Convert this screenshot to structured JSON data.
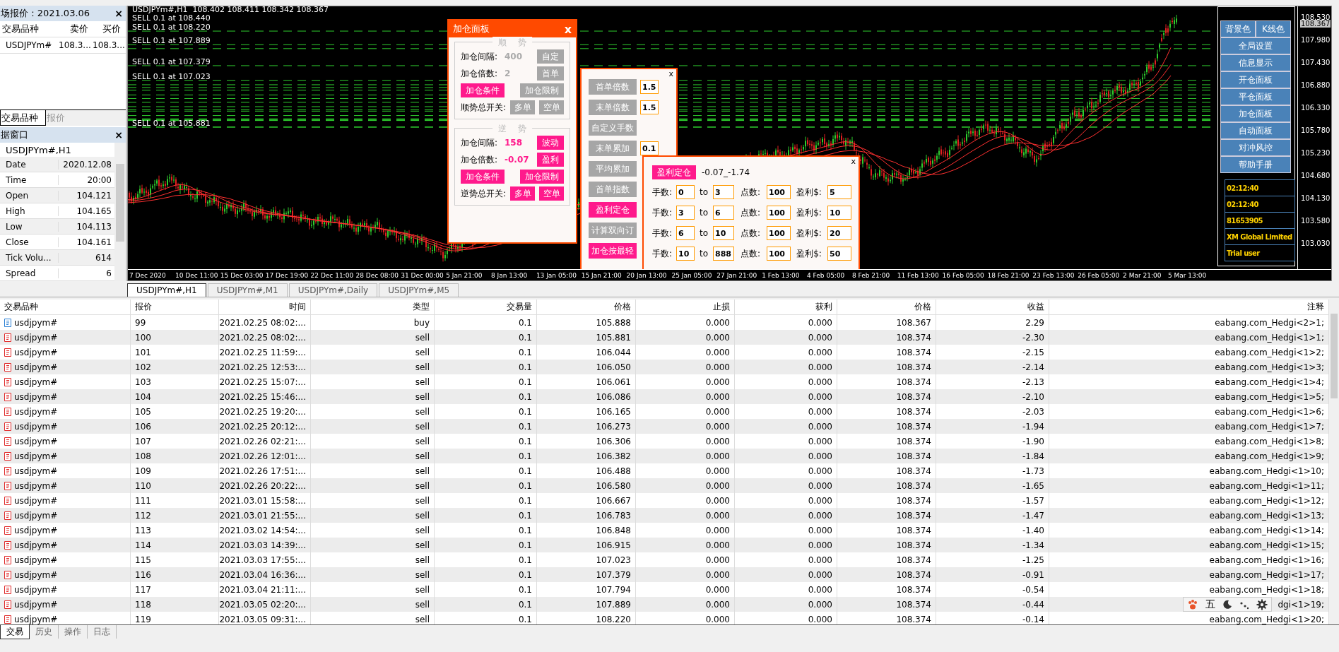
{
  "market_watch": {
    "title": "场报价 : 2021.03.06",
    "close": "×",
    "columns": [
      "交易品种",
      "卖价",
      "买价"
    ],
    "rows": [
      {
        "symbol": "USDJPYm#",
        "bid": "108.3...",
        "ask": "108.3..."
      }
    ],
    "tabs": [
      {
        "label": "交易品种",
        "selected": true
      },
      {
        "label": "报价",
        "selected": false
      }
    ]
  },
  "data_window": {
    "title": "据窗口",
    "close": "×",
    "symbol": "USDJPYm#,H1",
    "rows": [
      {
        "name": "Date",
        "value": "2020.12.08"
      },
      {
        "name": "Time",
        "value": "20:00"
      },
      {
        "name": "Open",
        "value": "104.121"
      },
      {
        "name": "High",
        "value": "104.165"
      },
      {
        "name": "Low",
        "value": "104.113"
      },
      {
        "name": "Close",
        "value": "104.161"
      },
      {
        "name": "Tick Volu...",
        "value": "614"
      },
      {
        "name": "Spread",
        "value": "6"
      }
    ]
  },
  "chart": {
    "legend": "USDJPYm#,H1  108.402 108.411 108.342 108.367",
    "order_labels": [
      "SELL 0.1 at 108.440",
      "SELL 0.1 at 108.220",
      "SELL 0.1 at 107.889",
      "SELL 0.1 at 107.379",
      "SELL 0.1 at 107.023",
      "SELL 0.1 at 105.881"
    ],
    "price_axis": [
      {
        "label": "108.530",
        "current": false
      },
      {
        "label": "108.367",
        "current": true
      },
      {
        "label": "107.980",
        "current": false
      },
      {
        "label": "107.430",
        "current": false
      },
      {
        "label": "106.880",
        "current": false
      },
      {
        "label": "106.330",
        "current": false
      },
      {
        "label": "105.780",
        "current": false
      },
      {
        "label": "105.230",
        "current": false
      },
      {
        "label": "104.680",
        "current": false
      },
      {
        "label": "104.130",
        "current": false
      },
      {
        "label": "103.580",
        "current": false
      },
      {
        "label": "103.030",
        "current": false
      }
    ],
    "time_axis": [
      "7 Dec 2020",
      "10 Dec 11:00",
      "15 Dec 03:00",
      "17 Dec 19:00",
      "22 Dec 11:00",
      "28 Dec 08:00",
      "31 Dec 00:00",
      "5 Jan 21:00",
      "8 Jan 13:00",
      "13 Jan 05:00",
      "15 Jan 21:00",
      "20 Jan 13:00",
      "25 Jan 05:00",
      "27 Jan 21:00",
      "1 Feb 13:00",
      "4 Feb 05:00",
      "8 Feb 21:00",
      "11 Feb 13:00",
      "16 Feb 05:00",
      "18 Feb 21:00",
      "23 Feb 13:00",
      "26 Feb 05:00",
      "2 Mar 21:00",
      "5 Mar 13:00"
    ]
  },
  "add_panel": {
    "title": "加仓面板",
    "close": "x",
    "sections": [
      {
        "legend": "顺 势",
        "highlighted": false,
        "rows": [
          {
            "label": "加仓间隔:",
            "value": "400",
            "button": {
              "label": "自定",
              "active": false
            }
          },
          {
            "label": "加仓倍数:",
            "value": "2",
            "button": {
              "label": "首单",
              "active": false
            }
          }
        ],
        "buttons": [
          {
            "label": "加仓条件",
            "active": true
          },
          {
            "label": "加仓限制",
            "active": false
          }
        ],
        "switch_label": "顺势总开关:",
        "switches": [
          {
            "label": "多单",
            "active": false
          },
          {
            "label": "空单",
            "active": false
          }
        ]
      },
      {
        "legend": "逆 势",
        "highlighted": true,
        "rows": [
          {
            "label": "加仓间隔:",
            "value": "158",
            "button": {
              "label": "波动",
              "active": true
            }
          },
          {
            "label": "加仓倍数:",
            "value": "-0.07",
            "button": {
              "label": "盈利",
              "active": true
            }
          }
        ],
        "buttons": [
          {
            "label": "加仓条件",
            "active": true
          },
          {
            "label": "加仓限制",
            "active": true
          }
        ],
        "switch_label": "逆势总开关:",
        "switches": [
          {
            "label": "多单",
            "active": true
          },
          {
            "label": "空单",
            "active": true
          }
        ]
      }
    ]
  },
  "multiplier_panel": {
    "close": "x",
    "items": [
      {
        "label": "首单倍数",
        "active": false,
        "value": "1.5"
      },
      {
        "label": "末单倍数",
        "active": false,
        "value": "1.5"
      },
      {
        "label": "自定义手数",
        "active": false
      },
      {
        "label": "末单累加",
        "active": false,
        "value": "0.1"
      },
      {
        "label": "平均累加",
        "active": false
      },
      {
        "label": "首单指数",
        "active": false
      },
      {
        "label": "盈利定仓",
        "active": true
      },
      {
        "label": "计算双向订",
        "active": false
      },
      {
        "label": "加仓按最轻",
        "active": true
      }
    ]
  },
  "profit_panel": {
    "close": "x",
    "button": {
      "label": "盈利定仓",
      "active": true
    },
    "summary": "-0.07_-1.74",
    "rows": [
      {
        "lots_label": "手数:",
        "from": "0",
        "to_label": "to",
        "to": "3",
        "points_label": "点数:",
        "points": "100",
        "profit_label": "盈利$:",
        "profit": "5"
      },
      {
        "lots_label": "手数:",
        "from": "3",
        "to_label": "to",
        "to": "6",
        "points_label": "点数:",
        "points": "100",
        "profit_label": "盈利$:",
        "profit": "10"
      },
      {
        "lots_label": "手数:",
        "from": "6",
        "to_label": "to",
        "to": "10",
        "points_label": "点数:",
        "points": "100",
        "profit_label": "盈利$:",
        "profit": "20"
      },
      {
        "lots_label": "手数:",
        "from": "10",
        "to_label": "to",
        "to": "888",
        "points_label": "点数:",
        "points": "100",
        "profit_label": "盈利$:",
        "profit": "50"
      }
    ]
  },
  "side_menu": {
    "top": [
      "背景色",
      "K线色"
    ],
    "items": [
      "全局设置",
      "信息显示",
      "开仓面板",
      "平仓面板",
      "加仓面板",
      "自动面板",
      "对冲风控",
      "帮助手册"
    ]
  },
  "info_box": [
    "02:12:40",
    "02:12:40",
    "81653905",
    "XM Global Limited",
    "Trial user"
  ],
  "chart_tabs": [
    {
      "label": "USDJPYm#,H1",
      "selected": true
    },
    {
      "label": "USDJPYm#,M1",
      "selected": false
    },
    {
      "label": "USDJPYm#,Daily",
      "selected": false
    },
    {
      "label": "USDJPYm#,M5",
      "selected": false
    }
  ],
  "trades": {
    "columns": [
      "交易品种",
      "报价",
      "时间",
      "类型",
      "交易量",
      "价格",
      "止损",
      "获利",
      "价格",
      "收益",
      "注释"
    ],
    "rows": [
      {
        "color": "#2a7fd4",
        "cells": [
          "usdjpym#",
          "99",
          "2021.02.25 08:02:...",
          "buy",
          "0.1",
          "105.888",
          "0.000",
          "0.000",
          "108.367",
          "2.29",
          "eabang.com_Hedgi<2>1;"
        ]
      },
      {
        "color": "#e02828",
        "cells": [
          "usdjpym#",
          "100",
          "2021.02.25 08:02:...",
          "sell",
          "0.1",
          "105.881",
          "0.000",
          "0.000",
          "108.374",
          "-2.30",
          "eabang.com_Hedgi<1>1;"
        ]
      },
      {
        "color": "#e02828",
        "cells": [
          "usdjpym#",
          "101",
          "2021.02.25 11:59:...",
          "sell",
          "0.1",
          "106.044",
          "0.000",
          "0.000",
          "108.374",
          "-2.15",
          "eabang.com_Hedgi<1>2;"
        ]
      },
      {
        "color": "#e02828",
        "cells": [
          "usdjpym#",
          "102",
          "2021.02.25 12:53:...",
          "sell",
          "0.1",
          "106.050",
          "0.000",
          "0.000",
          "108.374",
          "-2.14",
          "eabang.com_Hedgi<1>3;"
        ]
      },
      {
        "color": "#e02828",
        "cells": [
          "usdjpym#",
          "103",
          "2021.02.25 15:07:...",
          "sell",
          "0.1",
          "106.061",
          "0.000",
          "0.000",
          "108.374",
          "-2.13",
          "eabang.com_Hedgi<1>4;"
        ]
      },
      {
        "color": "#e02828",
        "cells": [
          "usdjpym#",
          "104",
          "2021.02.25 15:46:...",
          "sell",
          "0.1",
          "106.086",
          "0.000",
          "0.000",
          "108.374",
          "-2.10",
          "eabang.com_Hedgi<1>5;"
        ]
      },
      {
        "color": "#e02828",
        "cells": [
          "usdjpym#",
          "105",
          "2021.02.25 19:20:...",
          "sell",
          "0.1",
          "106.165",
          "0.000",
          "0.000",
          "108.374",
          "-2.03",
          "eabang.com_Hedgi<1>6;"
        ]
      },
      {
        "color": "#e02828",
        "cells": [
          "usdjpym#",
          "106",
          "2021.02.25 20:12:...",
          "sell",
          "0.1",
          "106.273",
          "0.000",
          "0.000",
          "108.374",
          "-1.94",
          "eabang.com_Hedgi<1>7;"
        ]
      },
      {
        "color": "#e02828",
        "cells": [
          "usdjpym#",
          "107",
          "2021.02.26 02:21:...",
          "sell",
          "0.1",
          "106.306",
          "0.000",
          "0.000",
          "108.374",
          "-1.90",
          "eabang.com_Hedgi<1>8;"
        ]
      },
      {
        "color": "#e02828",
        "cells": [
          "usdjpym#",
          "108",
          "2021.02.26 12:01:...",
          "sell",
          "0.1",
          "106.382",
          "0.000",
          "0.000",
          "108.374",
          "-1.84",
          "eabang.com_Hedgi<1>9;"
        ]
      },
      {
        "color": "#e02828",
        "cells": [
          "usdjpym#",
          "109",
          "2021.02.26 17:51:...",
          "sell",
          "0.1",
          "106.488",
          "0.000",
          "0.000",
          "108.374",
          "-1.73",
          "eabang.com_Hedgi<1>10;"
        ]
      },
      {
        "color": "#e02828",
        "cells": [
          "usdjpym#",
          "110",
          "2021.02.26 20:22:...",
          "sell",
          "0.1",
          "106.580",
          "0.000",
          "0.000",
          "108.374",
          "-1.65",
          "eabang.com_Hedgi<1>11;"
        ]
      },
      {
        "color": "#e02828",
        "cells": [
          "usdjpym#",
          "111",
          "2021.03.01 15:58:...",
          "sell",
          "0.1",
          "106.667",
          "0.000",
          "0.000",
          "108.374",
          "-1.57",
          "eabang.com_Hedgi<1>12;"
        ]
      },
      {
        "color": "#e02828",
        "cells": [
          "usdjpym#",
          "112",
          "2021.03.01 21:55:...",
          "sell",
          "0.1",
          "106.783",
          "0.000",
          "0.000",
          "108.374",
          "-1.47",
          "eabang.com_Hedgi<1>13;"
        ]
      },
      {
        "color": "#e02828",
        "cells": [
          "usdjpym#",
          "113",
          "2021.03.02 14:54:...",
          "sell",
          "0.1",
          "106.848",
          "0.000",
          "0.000",
          "108.374",
          "-1.40",
          "eabang.com_Hedgi<1>14;"
        ]
      },
      {
        "color": "#e02828",
        "cells": [
          "usdjpym#",
          "114",
          "2021.03.03 14:39:...",
          "sell",
          "0.1",
          "106.915",
          "0.000",
          "0.000",
          "108.374",
          "-1.34",
          "eabang.com_Hedgi<1>15;"
        ]
      },
      {
        "color": "#e02828",
        "cells": [
          "usdjpym#",
          "115",
          "2021.03.03 17:55:...",
          "sell",
          "0.1",
          "107.023",
          "0.000",
          "0.000",
          "108.374",
          "-1.25",
          "eabang.com_Hedgi<1>16;"
        ]
      },
      {
        "color": "#e02828",
        "cells": [
          "usdjpym#",
          "116",
          "2021.03.04 16:36:...",
          "sell",
          "0.1",
          "107.379",
          "0.000",
          "0.000",
          "108.374",
          "-0.91",
          "eabang.com_Hedgi<1>17;"
        ]
      },
      {
        "color": "#e02828",
        "cells": [
          "usdjpym#",
          "117",
          "2021.03.04 21:11:...",
          "sell",
          "0.1",
          "107.794",
          "0.000",
          "0.000",
          "108.374",
          "-0.54",
          "eabang.com_Hedgi<1>18;"
        ]
      },
      {
        "color": "#e02828",
        "cells": [
          "usdjpym#",
          "118",
          "2021.03.05 02:20:...",
          "sell",
          "0.1",
          "107.889",
          "0.000",
          "0.000",
          "108.374",
          "-0.44",
          "dgi<1>19;"
        ]
      },
      {
        "color": "#e02828",
        "cells": [
          "usdjpym#",
          "119",
          "2021.03.05 09:31:...",
          "sell",
          "0.1",
          "108.220",
          "0.000",
          "0.000",
          "108.374",
          "-0.14",
          "eabang.com_Hedgi<1>20;"
        ]
      }
    ]
  },
  "bottom_tabs": [
    {
      "label": "交易",
      "selected": true
    },
    {
      "label": "历史",
      "selected": false
    },
    {
      "label": "操作",
      "selected": false
    },
    {
      "label": "日志",
      "selected": false
    }
  ],
  "ime_toolbar": {
    "label": "五"
  }
}
